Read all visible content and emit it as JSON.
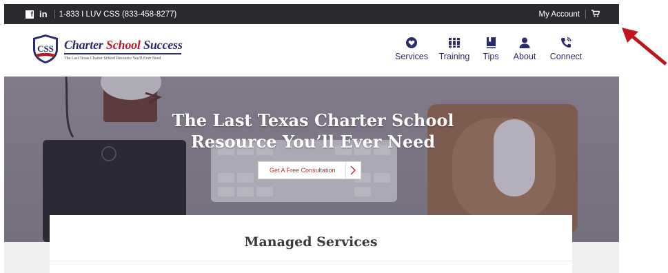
{
  "topbar": {
    "phone": "1-833 I LUV CSS (833-458-8277)",
    "my_account": "My Account",
    "social": [
      {
        "icon": "facebook-icon",
        "text": "f"
      },
      {
        "icon": "linkedin-icon",
        "text": "in"
      }
    ],
    "cart_icon": "cart-icon"
  },
  "brand": {
    "name_part1": "Charter ",
    "name_part2": "School",
    "name_part3": " Success",
    "tagline": "The Last Texas Charter School Resource You'll Ever Need",
    "shield_letters": "CSS",
    "colors": {
      "navy": "#2b2a6a",
      "red": "#b3202a"
    }
  },
  "nav": {
    "items": [
      {
        "label": "Services",
        "icon": "gear-heart-icon"
      },
      {
        "label": "Training",
        "icon": "books-icon"
      },
      {
        "label": "Tips",
        "icon": "bookmark-book-icon"
      },
      {
        "label": "About",
        "icon": "person-icon"
      },
      {
        "label": "Connect",
        "icon": "phone-icon"
      }
    ]
  },
  "hero": {
    "title_line1": "The Last Texas Charter School",
    "title_line2": "Resource You’ll Ever Need",
    "cta_label": "Get A Free Consultation"
  },
  "section": {
    "title": "Managed Services"
  },
  "annotation": {
    "icon": "red-arrow-icon",
    "color": "#c0141c"
  }
}
